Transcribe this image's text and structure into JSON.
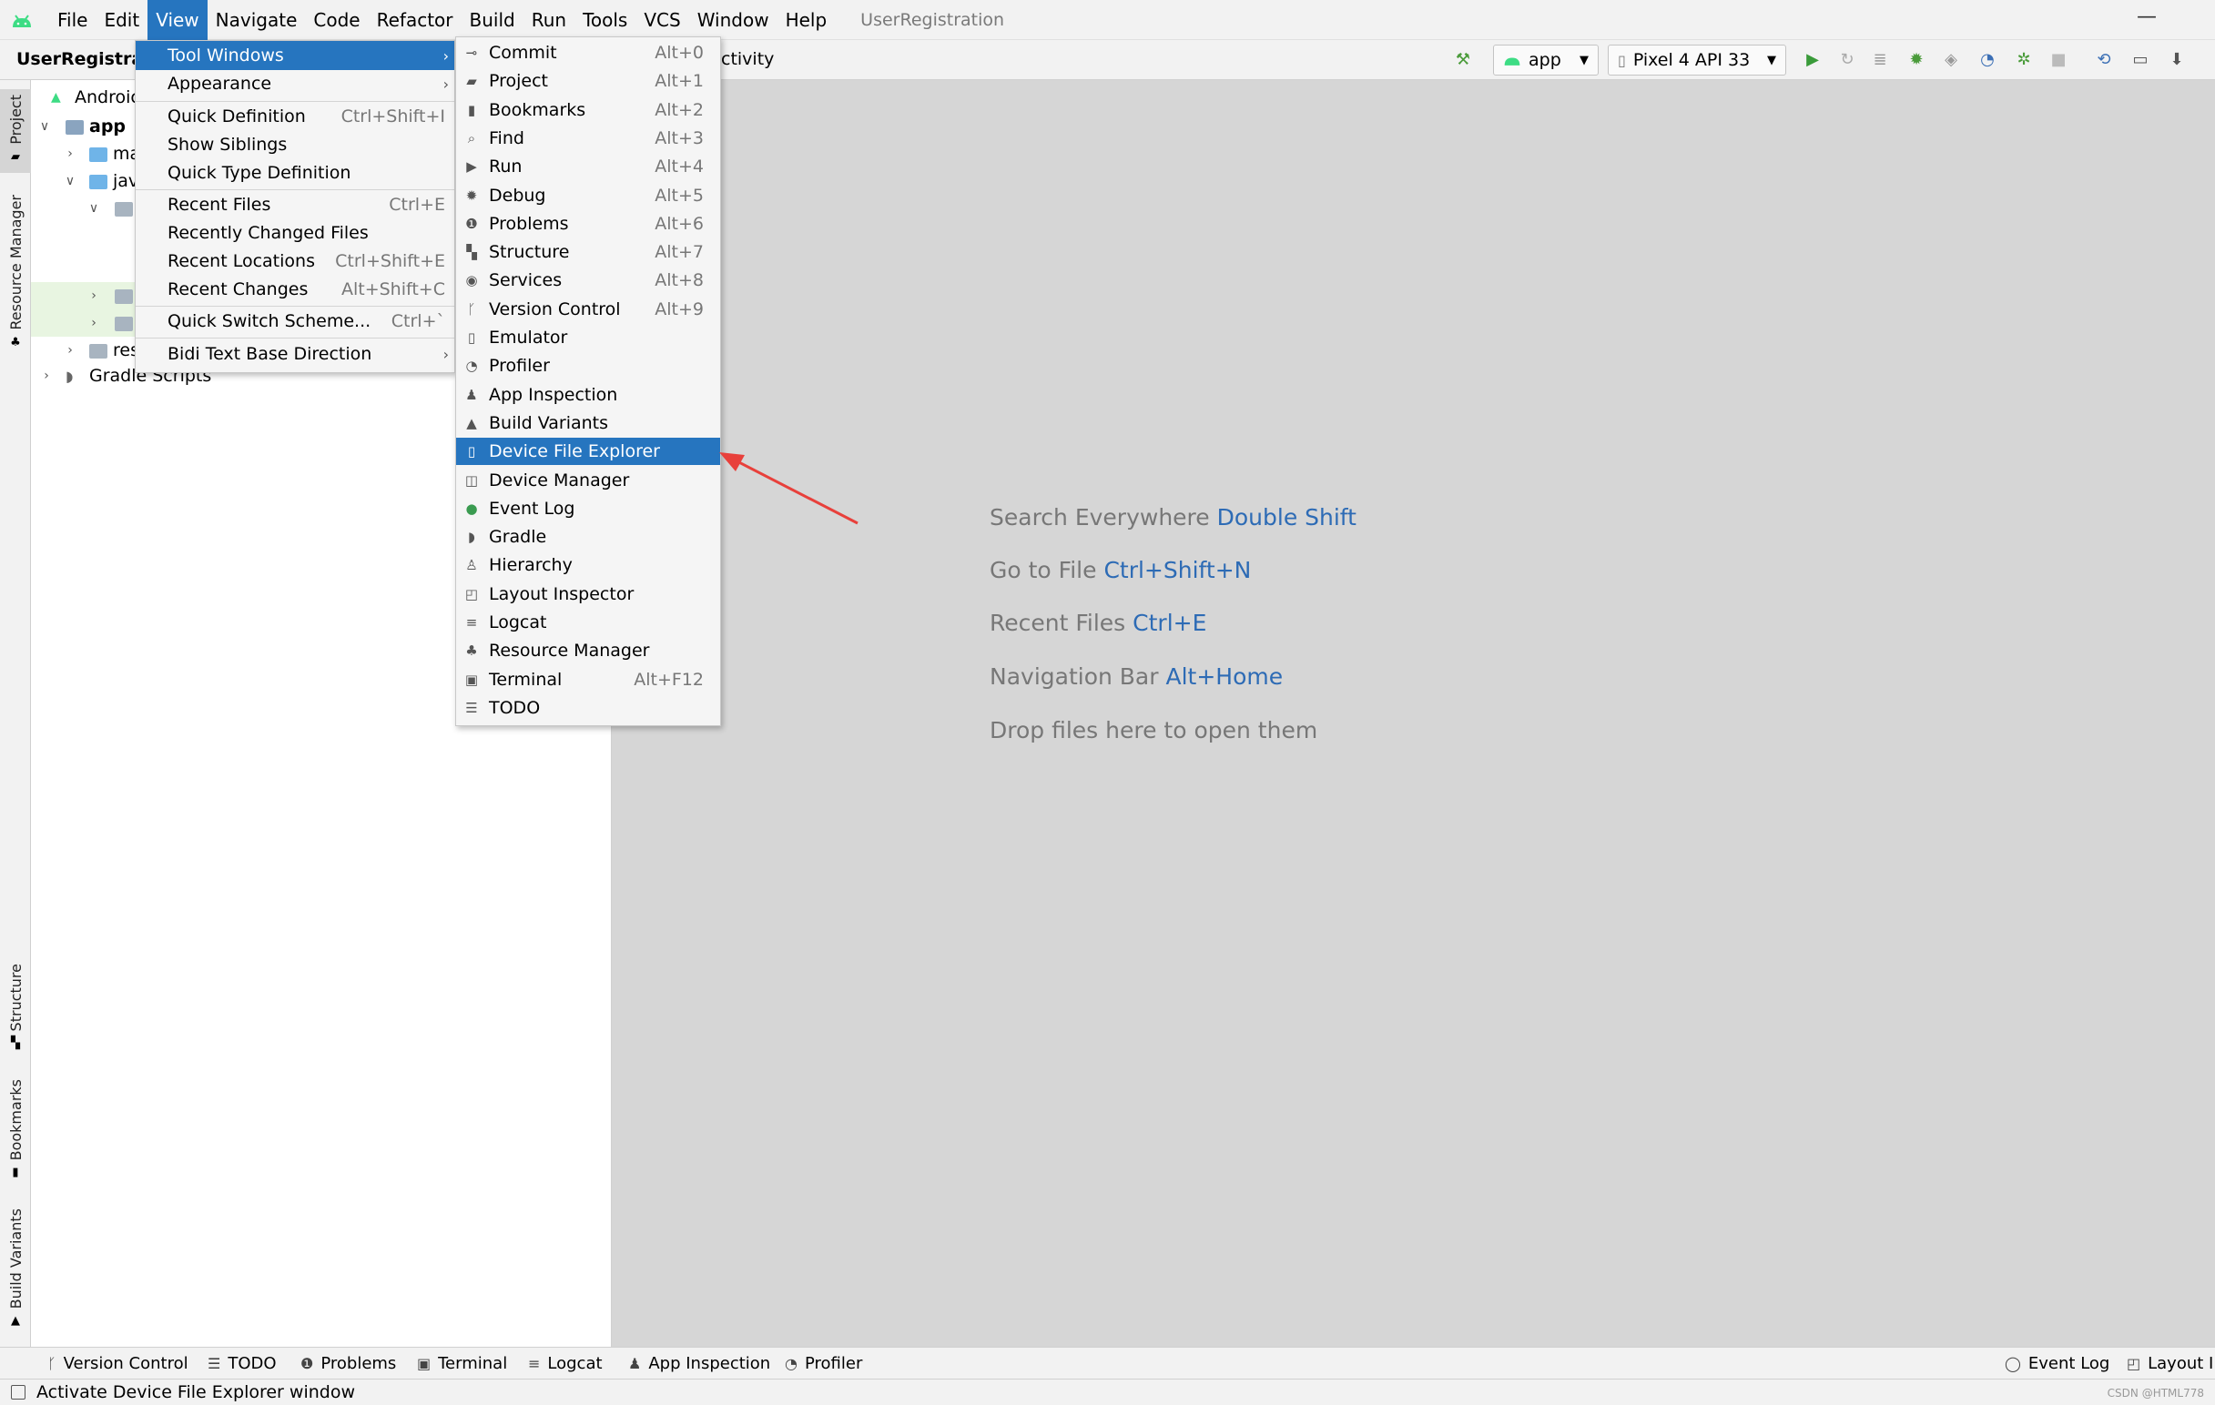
{
  "menubar": {
    "items": [
      "File",
      "Edit",
      "View",
      "Navigate",
      "Code",
      "Refactor",
      "Build",
      "Run",
      "Tools",
      "VCS",
      "Window",
      "Help"
    ],
    "window_title": "UserRegistration",
    "minimize": "—"
  },
  "toolbar": {
    "project_name": "UserRegistrati",
    "breadcrumb_tail": "ctivity",
    "run_config": "app",
    "device": "Pixel 4 API 33"
  },
  "left_strip": {
    "tabs": [
      "Project",
      "Resource Manager",
      "Structure",
      "Bookmarks",
      "Build Variants"
    ]
  },
  "project_tree": {
    "view_selector": "Androic",
    "rows": [
      "app",
      "ma",
      "jav",
      "",
      "",
      "",
      "res",
      "Gradle Scripts"
    ]
  },
  "view_menu": {
    "items": [
      {
        "label": "Tool Windows",
        "shortcut": ""
      },
      {
        "label": "Appearance",
        "shortcut": ""
      },
      {
        "label": "Quick Definition",
        "shortcut": "Ctrl+Shift+I"
      },
      {
        "label": "Show Siblings",
        "shortcut": ""
      },
      {
        "label": "Quick Type Definition",
        "shortcut": ""
      },
      {
        "label": "Recent Files",
        "shortcut": "Ctrl+E"
      },
      {
        "label": "Recently Changed Files",
        "shortcut": ""
      },
      {
        "label": "Recent Locations",
        "shortcut": "Ctrl+Shift+E"
      },
      {
        "label": "Recent Changes",
        "shortcut": "Alt+Shift+C"
      },
      {
        "label": "Quick Switch Scheme...",
        "shortcut": "Ctrl+`"
      },
      {
        "label": "Bidi Text Base Direction",
        "shortcut": ""
      }
    ]
  },
  "tool_windows_menu": {
    "items": [
      {
        "label": "Commit",
        "shortcut": "Alt+0",
        "icon": "commit-icon"
      },
      {
        "label": "Project",
        "shortcut": "Alt+1",
        "icon": "folder-icon"
      },
      {
        "label": "Bookmarks",
        "shortcut": "Alt+2",
        "icon": "bookmark-icon"
      },
      {
        "label": "Find",
        "shortcut": "Alt+3",
        "icon": "search-icon"
      },
      {
        "label": "Run",
        "shortcut": "Alt+4",
        "icon": "play-icon"
      },
      {
        "label": "Debug",
        "shortcut": "Alt+5",
        "icon": "bug-icon"
      },
      {
        "label": "Problems",
        "shortcut": "Alt+6",
        "icon": "warning-icon"
      },
      {
        "label": "Structure",
        "shortcut": "Alt+7",
        "icon": "structure-icon"
      },
      {
        "label": "Services",
        "shortcut": "Alt+8",
        "icon": "services-icon"
      },
      {
        "label": "Version Control",
        "shortcut": "Alt+9",
        "icon": "branch-icon"
      },
      {
        "label": "Emulator",
        "shortcut": "",
        "icon": "emulator-icon"
      },
      {
        "label": "Profiler",
        "shortcut": "",
        "icon": "gauge-icon"
      },
      {
        "label": "App Inspection",
        "shortcut": "",
        "icon": "inspection-icon"
      },
      {
        "label": "Build Variants",
        "shortcut": "",
        "icon": "android-icon"
      },
      {
        "label": "Device File Explorer",
        "shortcut": "",
        "icon": "device-icon"
      },
      {
        "label": "Device Manager",
        "shortcut": "",
        "icon": "device-manager-icon"
      },
      {
        "label": "Event Log",
        "shortcut": "",
        "icon": "event-log-icon"
      },
      {
        "label": "Gradle",
        "shortcut": "",
        "icon": "elephant-icon"
      },
      {
        "label": "Hierarchy",
        "shortcut": "",
        "icon": "hierarchy-icon"
      },
      {
        "label": "Layout Inspector",
        "shortcut": "",
        "icon": "layout-inspector-icon"
      },
      {
        "label": "Logcat",
        "shortcut": "",
        "icon": "logcat-icon"
      },
      {
        "label": "Resource Manager",
        "shortcut": "",
        "icon": "resource-icon"
      },
      {
        "label": "Terminal",
        "shortcut": "Alt+F12",
        "icon": "terminal-icon"
      },
      {
        "label": "TODO",
        "shortcut": "",
        "icon": "list-icon"
      }
    ]
  },
  "editor_hints": [
    {
      "text": "Search Everywhere ",
      "key": "Double Shift"
    },
    {
      "text": "Go to File ",
      "key": "Ctrl+Shift+N"
    },
    {
      "text": "Recent Files ",
      "key": "Ctrl+E"
    },
    {
      "text": "Navigation Bar ",
      "key": "Alt+Home"
    },
    {
      "text": "Drop files here to open them",
      "key": ""
    }
  ],
  "bottom_tabs": [
    "Version Control",
    "TODO",
    "Problems",
    "Terminal",
    "Logcat",
    "App Inspection",
    "Profiler"
  ],
  "bottom_right_tabs": [
    "Event Log",
    "Layout In"
  ],
  "status": {
    "text": "Activate Device File Explorer window",
    "watermark": "CSDN @HTML778"
  },
  "colors": {
    "highlight": "#2675bf",
    "annotation_arrow": "#e8403b",
    "link_key": "#2d6bb5"
  }
}
